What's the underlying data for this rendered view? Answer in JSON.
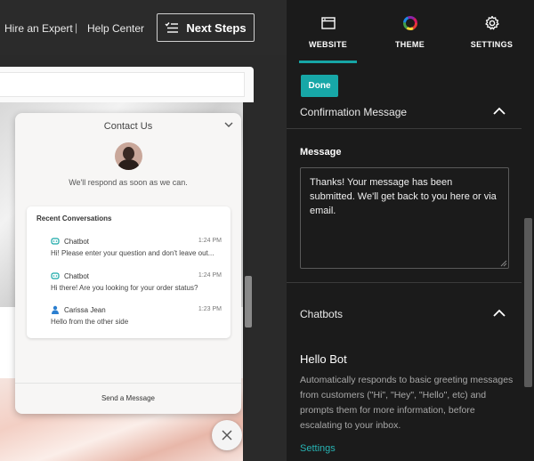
{
  "topbar": {
    "hire_expert": "Hire an Expert",
    "separator": "|",
    "help_center": "Help Center",
    "next_steps": "Next Steps"
  },
  "chat_widget": {
    "title": "Contact Us",
    "tagline": "We'll respond as soon as we can.",
    "recent_header": "Recent Conversations",
    "conversations": [
      {
        "name": "Chatbot",
        "time": "1:24 PM",
        "message": "Hi! Please enter your question and don't leave out..."
      },
      {
        "name": "Chatbot",
        "time": "1:24 PM",
        "message": "Hi there! Are you looking for your order status?"
      },
      {
        "name": "Carissa Jean",
        "time": "1:23 PM",
        "message": "Hello from the other side"
      }
    ],
    "send_message": "Send a Message"
  },
  "tabs": [
    {
      "label": "WEBSITE",
      "icon": "browser-window-icon",
      "active": true
    },
    {
      "label": "THEME",
      "icon": "color-wheel-icon",
      "active": false
    },
    {
      "label": "SETTINGS",
      "icon": "gear-icon",
      "active": false
    }
  ],
  "panel": {
    "done": "Done",
    "confirmation_title": "Confirmation Message",
    "message_label": "Message",
    "message_value": "Thanks! Your message has been submitted. We'll get back to you here or via email.",
    "chatbots_title": "Chatbots",
    "hello_bot_title": "Hello Bot",
    "hello_bot_desc": "Automatically responds to basic greeting messages from customers (\"Hi\", \"Hey\", \"Hello\", etc) and prompts them for more information, before escalating to your inbox.",
    "settings_link": "Settings"
  },
  "colors": {
    "accent": "#17a7a7",
    "panel_bg": "#1b1b1b",
    "topbar_bg": "#2b2b2b"
  }
}
